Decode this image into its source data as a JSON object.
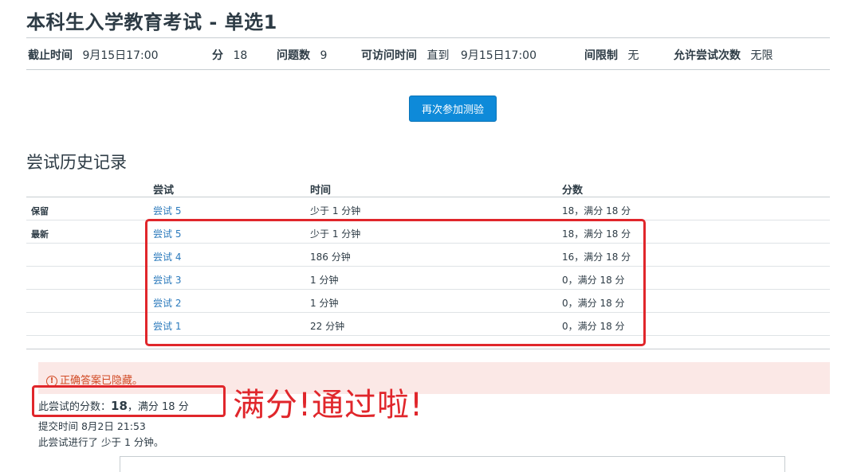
{
  "page_title": "本科生入学教育考试 - 单选1",
  "meta": {
    "due_label": "截止时间",
    "due_value": "9月15日17:00",
    "points_label": "分",
    "points_value": "18",
    "questions_label": "问题数",
    "questions_value": "9",
    "available_label": "可访问时间",
    "available_prefix": "直到",
    "available_value": "9月15日17:00",
    "time_limit_label": "间限制",
    "time_limit_value": "无",
    "attempts_label": "允许尝试次数",
    "attempts_value": "无限"
  },
  "retake_button": "再次参加测验",
  "history": {
    "title": "尝试历史记录",
    "headers": {
      "attempt": "尝试",
      "time": "时间",
      "score": "分数"
    },
    "rows": [
      {
        "label": "保留",
        "attempt": "尝试 5",
        "time": "少于 1 分钟",
        "score": "18，满分 18 分"
      },
      {
        "label": "最新",
        "attempt": "尝试 5",
        "time": "少于 1 分钟",
        "score": "18，满分 18 分"
      },
      {
        "label": "",
        "attempt": "尝试 4",
        "time": "186 分钟",
        "score": "16，满分 18 分"
      },
      {
        "label": "",
        "attempt": "尝试 3",
        "time": "1 分钟",
        "score": "0，满分 18 分"
      },
      {
        "label": "",
        "attempt": "尝试 2",
        "time": "1 分钟",
        "score": "0，满分 18 分"
      },
      {
        "label": "",
        "attempt": "尝试 1",
        "time": "22 分钟",
        "score": "0，满分 18 分"
      }
    ]
  },
  "alert": {
    "icon": "warning-circle-icon",
    "text": "正确答案已隐藏。"
  },
  "result": {
    "score_prefix": "此尝试的分数：",
    "score_value": "18",
    "score_suffix": "，满分 18 分",
    "submitted": "提交时间 8月2日 21:53",
    "duration": "此尝试进行了 少于 1 分钟。"
  },
  "annotation": {
    "text": "满分!通过啦!",
    "color": "#e0262b"
  },
  "colors": {
    "accent": "#0e8ad9",
    "link": "#2b7abc",
    "annotation": "#e0262b",
    "alert_bg": "#fbe8e6"
  }
}
